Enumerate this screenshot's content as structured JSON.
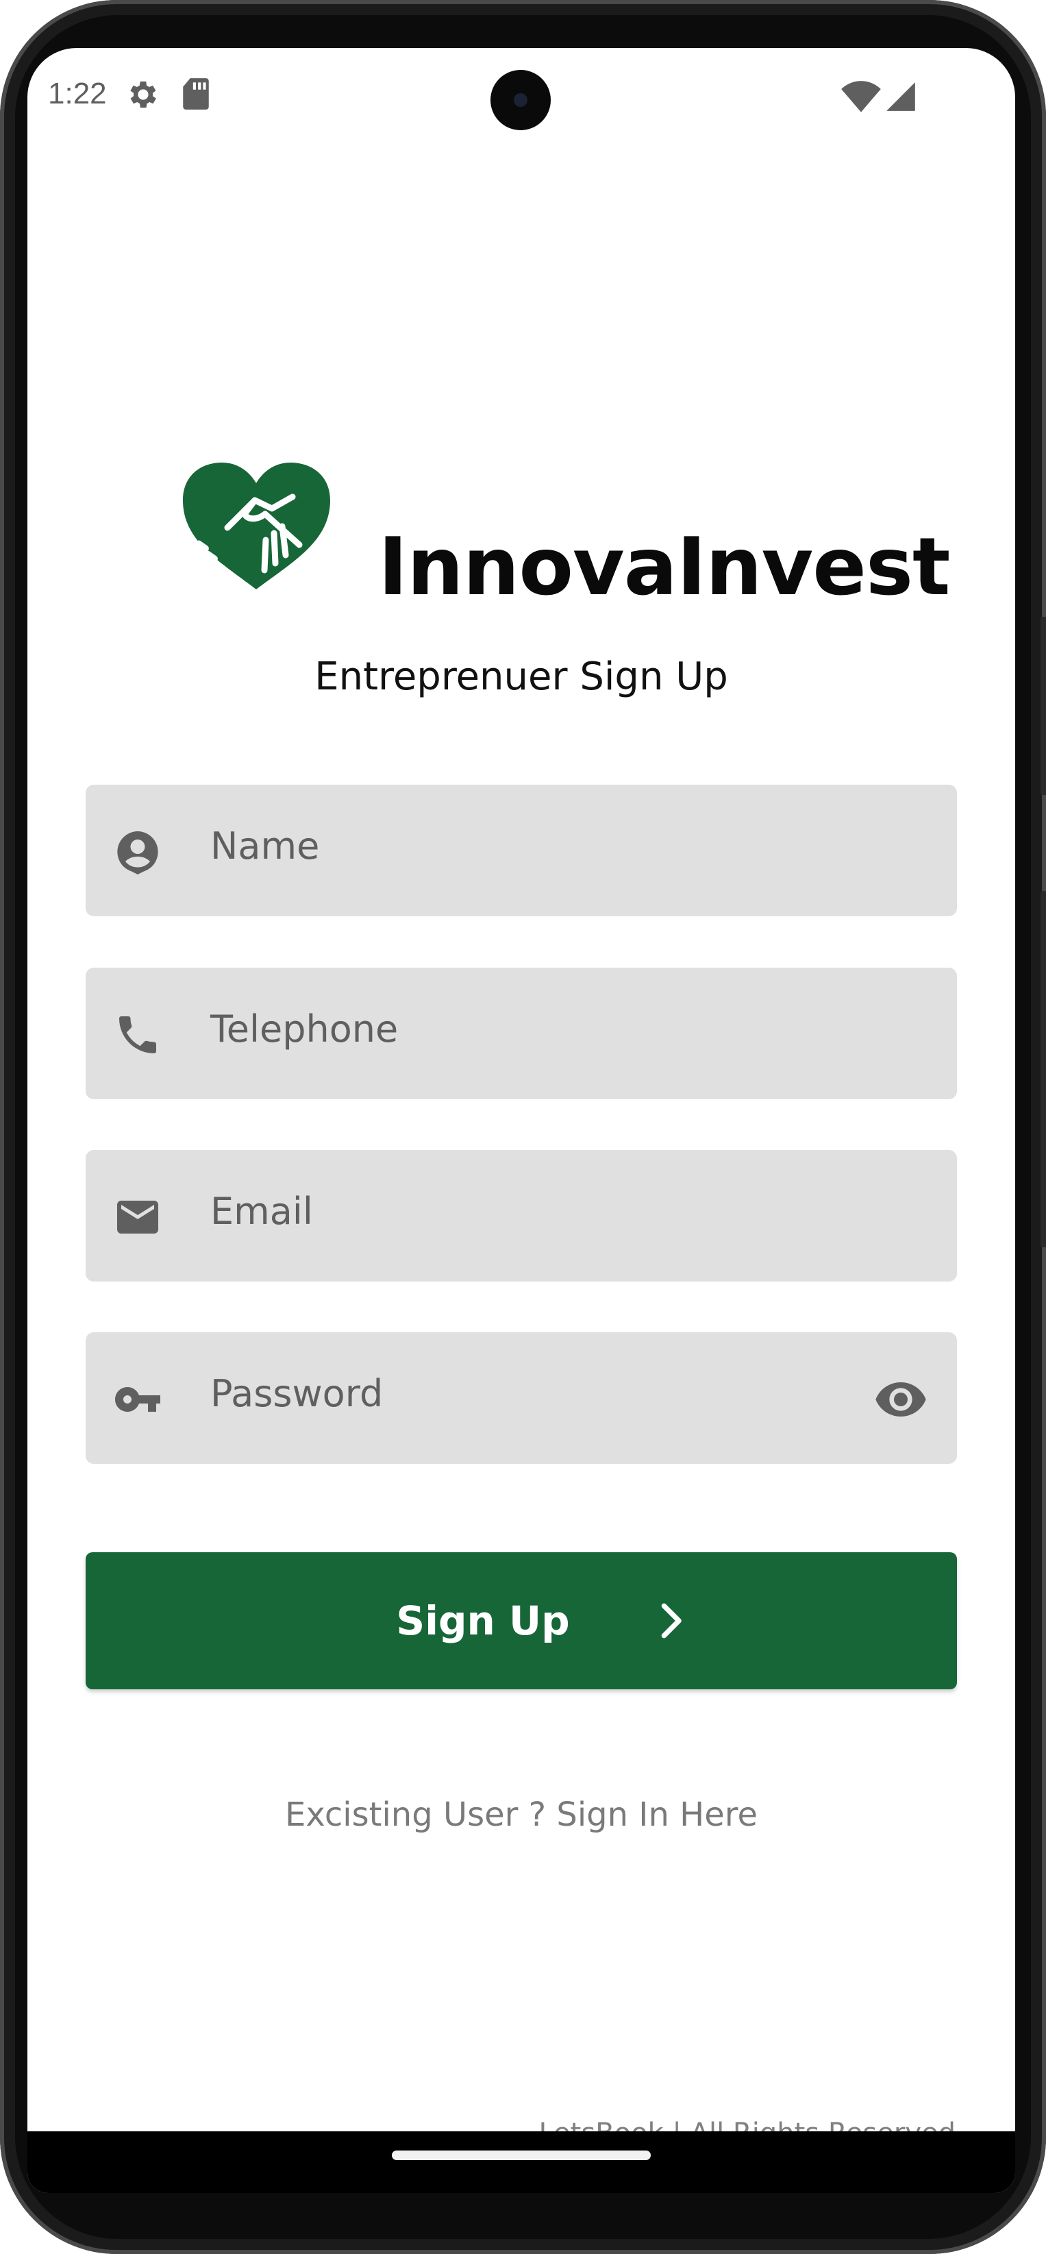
{
  "status_bar": {
    "time": "1:22",
    "icons": [
      "gear-icon",
      "sd-card-icon",
      "wifi-icon",
      "signal-icon"
    ]
  },
  "brand": {
    "name": "InnovaInvest",
    "logo_icon": "heart-handshake-icon",
    "color": "#176638"
  },
  "page": {
    "title": "Entreprenuer Sign Up"
  },
  "form": {
    "fields": [
      {
        "placeholder": "Name",
        "icon": "person-icon",
        "value": ""
      },
      {
        "placeholder": "Telephone",
        "icon": "phone-icon",
        "value": ""
      },
      {
        "placeholder": "Email",
        "icon": "mail-icon",
        "value": ""
      },
      {
        "placeholder": "Password",
        "icon": "key-icon",
        "value": "",
        "trailing_icon": "eye-icon"
      }
    ],
    "submit_label": "Sign Up",
    "submit_icon": "chevron-right-icon",
    "submit_color": "#176638"
  },
  "links": {
    "signin": "Excisting User ? Sign In Here"
  },
  "footer": {
    "text": "LetsBook | All Rights Reserved"
  },
  "colors": {
    "field_bg": "#e0e0e0",
    "icon_gray": "#5f5f5f",
    "link_gray": "#7a7a7a"
  }
}
